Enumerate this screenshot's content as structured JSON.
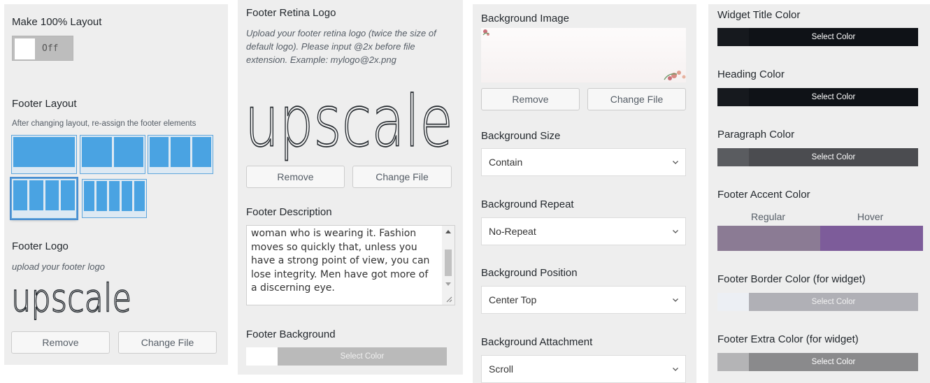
{
  "panel1": {
    "layout100": {
      "title": "Make 100% Layout",
      "toggle_value": "Off"
    },
    "footer_layout": {
      "title": "Footer Layout",
      "description": "After changing layout, re-assign the footer elements"
    },
    "footer_logo": {
      "title": "Footer Logo",
      "description": "upload your footer logo",
      "logo_text": "upscale",
      "remove_label": "Remove",
      "change_label": "Change File"
    }
  },
  "panel2": {
    "retina_logo": {
      "title": "Footer Retina Logo",
      "description": "Upload your footer retina logo (twice the size of default logo). Please input @2x before file extension. Example: mylogo@2x.png",
      "logo_text": "upscale",
      "remove_label": "Remove",
      "change_label": "Change File"
    },
    "footer_description": {
      "title": "Footer Description",
      "text": "woman who is wearing it. Fashion moves so quickly that, unless you have a strong point of view, you can lose integrity. Men have got more of a discerning eye."
    },
    "footer_background": {
      "title": "Footer Background",
      "button_label": "Select Color",
      "swatch_color": "#ffffff",
      "bar_color": "#bababa"
    }
  },
  "panel3": {
    "background_image": {
      "title": "Background Image",
      "remove_label": "Remove",
      "change_label": "Change File"
    },
    "background_size": {
      "title": "Background Size",
      "value": "Contain"
    },
    "background_repeat": {
      "title": "Background Repeat",
      "value": "No-Repeat"
    },
    "background_position": {
      "title": "Background Position",
      "value": "Center Top"
    },
    "background_attachment": {
      "title": "Background Attachment",
      "value": "Scroll"
    }
  },
  "panel4": {
    "widget_title_color": {
      "title": "Widget Title Color",
      "button_label": "Select Color",
      "swatch_color": "#16191e",
      "bar_color": "#0f1217"
    },
    "heading_color": {
      "title": "Heading Color",
      "button_label": "Select Color",
      "swatch_color": "#16191e",
      "bar_color": "#0f1217"
    },
    "paragraph_color": {
      "title": "Paragraph Color",
      "button_label": "Select Color",
      "swatch_color": "#5a5c60",
      "bar_color": "#4b4c50"
    },
    "footer_accent_color": {
      "title": "Footer Accent Color",
      "regular_label": "Regular",
      "hover_label": "Hover",
      "regular_color": "#8b7b94",
      "hover_color": "#7d5c9a"
    },
    "footer_border_color": {
      "title": "Footer Border Color (for widget)",
      "button_label": "Select Color",
      "swatch_color": "#eceff4",
      "bar_color": "#b0b0b6"
    },
    "footer_extra_color": {
      "title": "Footer Extra Color (for widget)",
      "button_label": "Select Color",
      "swatch_color": "#b4b4b6",
      "bar_color": "#8a8a8c"
    }
  }
}
